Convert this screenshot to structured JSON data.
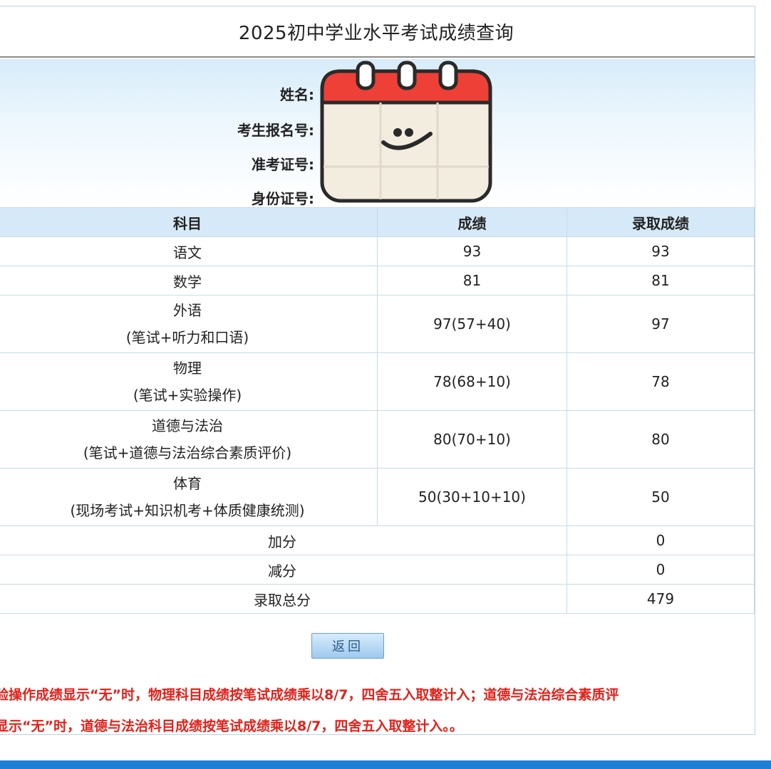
{
  "page": {
    "title": "2025初中学业水平考试成绩查询"
  },
  "info": [
    {
      "label": "姓名:",
      "value": ""
    },
    {
      "label": "考生报名号:",
      "value": ""
    },
    {
      "label": "准考证号:",
      "value": ""
    },
    {
      "label": "身份证号:",
      "value": ""
    }
  ],
  "table": {
    "headers": [
      "科目",
      "成绩",
      "录取成绩"
    ],
    "rows": [
      {
        "subject": "语文",
        "detail": "",
        "score": "93",
        "admission": "93"
      },
      {
        "subject": "数学",
        "detail": "",
        "score": "81",
        "admission": "81"
      },
      {
        "subject": "外语",
        "detail": "(笔试+听力和口语)",
        "score": "97(57+40)",
        "admission": "97"
      },
      {
        "subject": "物理",
        "detail": "(笔试+实验操作)",
        "score": "78(68+10)",
        "admission": "78"
      },
      {
        "subject": "道德与法治",
        "detail": "(笔试+道德与法治综合素质评价)",
        "score": "80(70+10)",
        "admission": "80"
      },
      {
        "subject": "体育",
        "detail": "(现场考试+知识机考+体质健康统测)",
        "score": "50(30+10+10)",
        "admission": "50"
      }
    ],
    "summary": [
      {
        "label": "加分",
        "value": "0"
      },
      {
        "label": "减分",
        "value": "0"
      },
      {
        "label": "录取总分",
        "value": "479"
      }
    ]
  },
  "buttons": {
    "back": "返回"
  },
  "notes": [
    "验操作成绩显示“无”时，物理科目成绩按笔试成绩乘以8/7，四舍五入取整计入；道德与法治综合素质评",
    "显示“无”时，道德与法治科目成绩按笔试成绩乘以8/7，四舍五入取整计入。。"
  ],
  "colors": {
    "note_red": "#e0221b",
    "header_blue": "#d6e9f8",
    "bottom_bar": "#1e7fd6",
    "calendar_red": "#ee4036"
  },
  "icons": {
    "sticker": "calendar-smiley-icon"
  }
}
